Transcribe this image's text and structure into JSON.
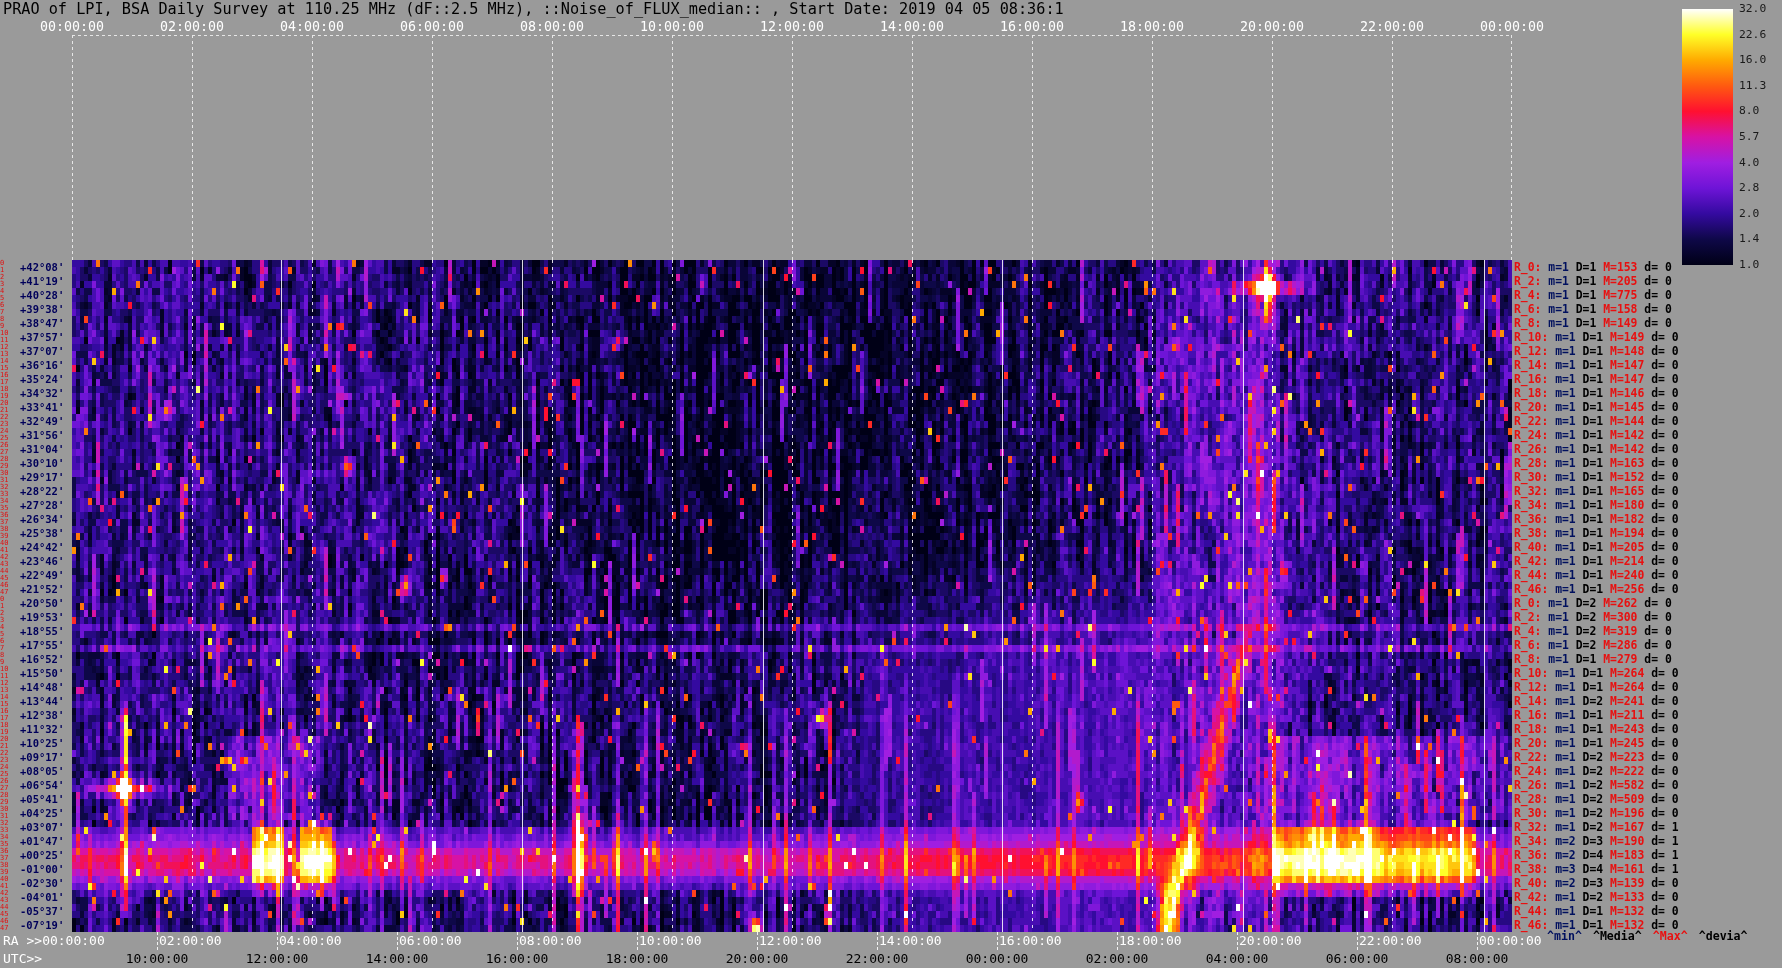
{
  "title": "PRAO of LPI, BSA Daily Survey at 110.25 MHz (dF::2.5 MHz), ::Noise_of_FLUX_median:: , Start Date: 2019 04 05 08:36:1",
  "top_axis": {
    "ticks": [
      "00:00:00",
      "02:00:00",
      "04:00:00",
      "06:00:00",
      "08:00:00",
      "10:00:00",
      "12:00:00",
      "14:00:00",
      "16:00:00",
      "18:00:00",
      "20:00:00",
      "22:00:00",
      "00:00:00"
    ]
  },
  "colorbar": {
    "ticks": [
      "32.0",
      "22.6",
      "16.0",
      "11.3",
      "8.0",
      "5.7",
      "4.0",
      "2.8",
      "2.0",
      "1.4",
      "1.0"
    ]
  },
  "declination_axis": {
    "rows": [
      {
        "indices": [
          "0",
          "1"
        ],
        "dec": "+42°08'"
      },
      {
        "indices": [
          "2",
          "3"
        ],
        "dec": "+41°19'"
      },
      {
        "indices": [
          "4",
          "5"
        ],
        "dec": "+40°28'"
      },
      {
        "indices": [
          "6",
          "7"
        ],
        "dec": "+39°38'"
      },
      {
        "indices": [
          "8",
          "9"
        ],
        "dec": "+38°47'"
      },
      {
        "indices": [
          "10",
          "11"
        ],
        "dec": "+37°57'"
      },
      {
        "indices": [
          "12",
          "13"
        ],
        "dec": "+37°07'"
      },
      {
        "indices": [
          "14",
          "15"
        ],
        "dec": "+36°16'"
      },
      {
        "indices": [
          "16",
          "17"
        ],
        "dec": "+35°24'"
      },
      {
        "indices": [
          "18",
          "19"
        ],
        "dec": "+34°32'"
      },
      {
        "indices": [
          "20",
          "21"
        ],
        "dec": "+33°41'"
      },
      {
        "indices": [
          "22",
          "23"
        ],
        "dec": "+32°49'"
      },
      {
        "indices": [
          "24",
          "25"
        ],
        "dec": "+31°56'"
      },
      {
        "indices": [
          "26",
          "27"
        ],
        "dec": "+31°04'"
      },
      {
        "indices": [
          "28",
          "29"
        ],
        "dec": "+30°10'"
      },
      {
        "indices": [
          "30",
          "31"
        ],
        "dec": "+29°17'"
      },
      {
        "indices": [
          "32",
          "33"
        ],
        "dec": "+28°22'"
      },
      {
        "indices": [
          "34",
          "35"
        ],
        "dec": "+27°28'"
      },
      {
        "indices": [
          "36",
          "37"
        ],
        "dec": "+26°34'"
      },
      {
        "indices": [
          "38",
          "39"
        ],
        "dec": "+25°38'"
      },
      {
        "indices": [
          "40",
          "41"
        ],
        "dec": "+24°42'"
      },
      {
        "indices": [
          "42",
          "43"
        ],
        "dec": "+23°46'"
      },
      {
        "indices": [
          "44",
          "45"
        ],
        "dec": "+22°49'"
      },
      {
        "indices": [
          "46",
          "47"
        ],
        "dec": "+21°52'"
      },
      {
        "indices": [
          "0",
          "1"
        ],
        "dec": "+20°50'"
      },
      {
        "indices": [
          "2",
          "3"
        ],
        "dec": "+19°53'"
      },
      {
        "indices": [
          "4",
          "5"
        ],
        "dec": "+18°55'"
      },
      {
        "indices": [
          "6",
          "7"
        ],
        "dec": "+17°55'"
      },
      {
        "indices": [
          "8",
          "9"
        ],
        "dec": "+16°52'"
      },
      {
        "indices": [
          "10",
          "11"
        ],
        "dec": "+15°50'"
      },
      {
        "indices": [
          "12",
          "13"
        ],
        "dec": "+14°48'"
      },
      {
        "indices": [
          "14",
          "15"
        ],
        "dec": "+13°44'"
      },
      {
        "indices": [
          "16",
          "17"
        ],
        "dec": "+12°38'"
      },
      {
        "indices": [
          "18",
          "19"
        ],
        "dec": "+11°32'"
      },
      {
        "indices": [
          "20",
          "21"
        ],
        "dec": "+10°25'"
      },
      {
        "indices": [
          "22",
          "23"
        ],
        "dec": "+09°17'"
      },
      {
        "indices": [
          "24",
          "25"
        ],
        "dec": "+08°05'"
      },
      {
        "indices": [
          "26",
          "27"
        ],
        "dec": "+06°54'"
      },
      {
        "indices": [
          "28",
          "29"
        ],
        "dec": "+05°41'"
      },
      {
        "indices": [
          "30",
          "31"
        ],
        "dec": "+04°25'"
      },
      {
        "indices": [
          "32",
          "33"
        ],
        "dec": "+03°07'"
      },
      {
        "indices": [
          "34",
          "35"
        ],
        "dec": "+01°47'"
      },
      {
        "indices": [
          "36",
          "37"
        ],
        "dec": "+00°25'"
      },
      {
        "indices": [
          "38",
          "39"
        ],
        "dec": "-01°00'"
      },
      {
        "indices": [
          "40",
          "41"
        ],
        "dec": "-02°30'"
      },
      {
        "indices": [
          "42",
          "43"
        ],
        "dec": "-04°01'"
      },
      {
        "indices": [
          "44",
          "45"
        ],
        "dec": "-05°37'"
      },
      {
        "indices": [
          "46",
          "47"
        ],
        "dec": "-07°19'"
      }
    ]
  },
  "row_stats": [
    {
      "ring": "R_0:",
      "min": "m=1",
      "median": "D=1",
      "max": "M=153",
      "deviation": "d= 0"
    },
    {
      "ring": "R_2:",
      "min": "m=1",
      "median": "D=1",
      "max": "M=205",
      "deviation": "d= 0"
    },
    {
      "ring": "R_4:",
      "min": "m=1",
      "median": "D=1",
      "max": "M=775",
      "deviation": "d= 0"
    },
    {
      "ring": "R_6:",
      "min": "m=1",
      "median": "D=1",
      "max": "M=158",
      "deviation": "d= 0"
    },
    {
      "ring": "R_8:",
      "min": "m=1",
      "median": "D=1",
      "max": "M=149",
      "deviation": "d= 0"
    },
    {
      "ring": "R_10:",
      "min": "m=1",
      "median": "D=1",
      "max": "M=149",
      "deviation": "d= 0"
    },
    {
      "ring": "R_12:",
      "min": "m=1",
      "median": "D=1",
      "max": "M=148",
      "deviation": "d= 0"
    },
    {
      "ring": "R_14:",
      "min": "m=1",
      "median": "D=1",
      "max": "M=147",
      "deviation": "d= 0"
    },
    {
      "ring": "R_16:",
      "min": "m=1",
      "median": "D=1",
      "max": "M=147",
      "deviation": "d= 0"
    },
    {
      "ring": "R_18:",
      "min": "m=1",
      "median": "D=1",
      "max": "M=146",
      "deviation": "d= 0"
    },
    {
      "ring": "R_20:",
      "min": "m=1",
      "median": "D=1",
      "max": "M=145",
      "deviation": "d= 0"
    },
    {
      "ring": "R_22:",
      "min": "m=1",
      "median": "D=1",
      "max": "M=144",
      "deviation": "d= 0"
    },
    {
      "ring": "R_24:",
      "min": "m=1",
      "median": "D=1",
      "max": "M=142",
      "deviation": "d= 0"
    },
    {
      "ring": "R_26:",
      "min": "m=1",
      "median": "D=1",
      "max": "M=142",
      "deviation": "d= 0"
    },
    {
      "ring": "R_28:",
      "min": "m=1",
      "median": "D=1",
      "max": "M=163",
      "deviation": "d= 0"
    },
    {
      "ring": "R_30:",
      "min": "m=1",
      "median": "D=1",
      "max": "M=152",
      "deviation": "d= 0"
    },
    {
      "ring": "R_32:",
      "min": "m=1",
      "median": "D=1",
      "max": "M=165",
      "deviation": "d= 0"
    },
    {
      "ring": "R_34:",
      "min": "m=1",
      "median": "D=1",
      "max": "M=180",
      "deviation": "d= 0"
    },
    {
      "ring": "R_36:",
      "min": "m=1",
      "median": "D=1",
      "max": "M=182",
      "deviation": "d= 0"
    },
    {
      "ring": "R_38:",
      "min": "m=1",
      "median": "D=1",
      "max": "M=194",
      "deviation": "d= 0"
    },
    {
      "ring": "R_40:",
      "min": "m=1",
      "median": "D=1",
      "max": "M=205",
      "deviation": "d= 0"
    },
    {
      "ring": "R_42:",
      "min": "m=1",
      "median": "D=1",
      "max": "M=214",
      "deviation": "d= 0"
    },
    {
      "ring": "R_44:",
      "min": "m=1",
      "median": "D=1",
      "max": "M=240",
      "deviation": "d= 0"
    },
    {
      "ring": "R_46:",
      "min": "m=1",
      "median": "D=1",
      "max": "M=256",
      "deviation": "d= 0"
    },
    {
      "ring": "R_0:",
      "min": "m=1",
      "median": "D=2",
      "max": "M=262",
      "deviation": "d= 0"
    },
    {
      "ring": "R_2:",
      "min": "m=1",
      "median": "D=2",
      "max": "M=300",
      "deviation": "d= 0"
    },
    {
      "ring": "R_4:",
      "min": "m=1",
      "median": "D=2",
      "max": "M=319",
      "deviation": "d= 0"
    },
    {
      "ring": "R_6:",
      "min": "m=1",
      "median": "D=2",
      "max": "M=286",
      "deviation": "d= 0"
    },
    {
      "ring": "R_8:",
      "min": "m=1",
      "median": "D=1",
      "max": "M=279",
      "deviation": "d= 0"
    },
    {
      "ring": "R_10:",
      "min": "m=1",
      "median": "D=1",
      "max": "M=264",
      "deviation": "d= 0"
    },
    {
      "ring": "R_12:",
      "min": "m=1",
      "median": "D=1",
      "max": "M=264",
      "deviation": "d= 0"
    },
    {
      "ring": "R_14:",
      "min": "m=1",
      "median": "D=2",
      "max": "M=241",
      "deviation": "d= 0"
    },
    {
      "ring": "R_16:",
      "min": "m=1",
      "median": "D=1",
      "max": "M=211",
      "deviation": "d= 0"
    },
    {
      "ring": "R_18:",
      "min": "m=1",
      "median": "D=1",
      "max": "M=243",
      "deviation": "d= 0"
    },
    {
      "ring": "R_20:",
      "min": "m=1",
      "median": "D=1",
      "max": "M=245",
      "deviation": "d= 0"
    },
    {
      "ring": "R_22:",
      "min": "m=1",
      "median": "D=2",
      "max": "M=223",
      "deviation": "d= 0"
    },
    {
      "ring": "R_24:",
      "min": "m=1",
      "median": "D=2",
      "max": "M=222",
      "deviation": "d= 0"
    },
    {
      "ring": "R_26:",
      "min": "m=1",
      "median": "D=2",
      "max": "M=582",
      "deviation": "d= 0"
    },
    {
      "ring": "R_28:",
      "min": "m=1",
      "median": "D=2",
      "max": "M=509",
      "deviation": "d= 0"
    },
    {
      "ring": "R_30:",
      "min": "m=1",
      "median": "D=2",
      "max": "M=196",
      "deviation": "d= 0"
    },
    {
      "ring": "R_32:",
      "min": "m=1",
      "median": "D=2",
      "max": "M=167",
      "deviation": "d= 1"
    },
    {
      "ring": "R_34:",
      "min": "m=2",
      "median": "D=3",
      "max": "M=190",
      "deviation": "d= 1"
    },
    {
      "ring": "R_36:",
      "min": "m=2",
      "median": "D=4",
      "max": "M=183",
      "deviation": "d= 1"
    },
    {
      "ring": "R_38:",
      "min": "m=3",
      "median": "D=4",
      "max": "M=161",
      "deviation": "d= 1"
    },
    {
      "ring": "R_40:",
      "min": "m=2",
      "median": "D=3",
      "max": "M=139",
      "deviation": "d= 0"
    },
    {
      "ring": "R_42:",
      "min": "m=1",
      "median": "D=2",
      "max": "M=133",
      "deviation": "d= 0"
    },
    {
      "ring": "R_44:",
      "min": "m=1",
      "median": "D=1",
      "max": "M=132",
      "deviation": "d= 0"
    },
    {
      "ring": "R_46:",
      "min": "m=1",
      "median": "D=1",
      "max": "M=132",
      "deviation": "d= 0"
    }
  ],
  "stats_legend": [
    {
      "kind": "min",
      "text": "^min^"
    },
    {
      "kind": "median",
      "text": "^Media^"
    },
    {
      "kind": "max",
      "text": "^Max^"
    },
    {
      "kind": "deviation",
      "text": "^devia^"
    }
  ],
  "ra_axis": {
    "label": "RA >>",
    "start": "00:00:00",
    "ticks": [
      "02:00:00",
      "04:00:00",
      "06:00:00",
      "08:00:00",
      "10:00:00",
      "12:00:00",
      "14:00:00",
      "16:00:00",
      "18:00:00",
      "20:00:00",
      "22:00:00",
      "00:00:00"
    ]
  },
  "utc_axis": {
    "label": "UTC>>",
    "ticks": [
      "10:00:00",
      "12:00:00",
      "14:00:00",
      "16:00:00",
      "18:00:00",
      "20:00:00",
      "22:00:00",
      "00:00:00",
      "02:00:00",
      "04:00:00",
      "06:00:00",
      "08:00:00"
    ]
  }
}
